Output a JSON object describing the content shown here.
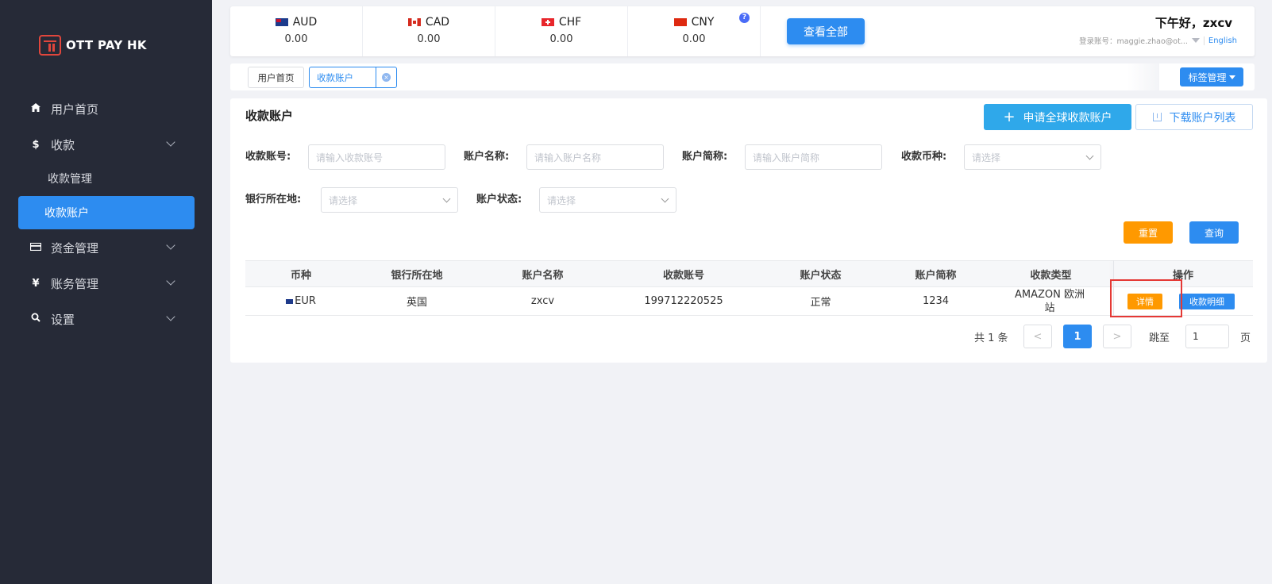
{
  "sidebar": {
    "brand": "OTT PAY HK",
    "items": [
      {
        "label": "用户首页",
        "icon": "home-icon"
      },
      {
        "label": "收款",
        "icon": "dollar-icon"
      },
      {
        "label": "收款管理"
      },
      {
        "label": "收款账户"
      },
      {
        "label": "资金管理",
        "icon": "card-icon"
      },
      {
        "label": "账务管理",
        "icon": "yen-icon"
      },
      {
        "label": "设置",
        "icon": "search-icon"
      }
    ]
  },
  "currencies": [
    {
      "code": "AUD",
      "value": "0.00"
    },
    {
      "code": "CAD",
      "value": "0.00"
    },
    {
      "code": "CHF",
      "value": "0.00"
    },
    {
      "code": "CNY",
      "value": "0.00"
    }
  ],
  "header": {
    "help": "?",
    "view_all": "查看全部",
    "greeting": "下午好，zxcv",
    "account": "登录账号：maggie.zhao@ot...",
    "language": "English"
  },
  "tabs": {
    "items": [
      "用户首页",
      "收款账户"
    ],
    "close": "×",
    "tag_management": "标签管理"
  },
  "page": {
    "title": "收款账户",
    "apply_plus": "+",
    "apply_button": "申请全球收款账户",
    "download_button": "下载账户列表"
  },
  "filters": {
    "account_no_label": "收款账号:",
    "account_no_placeholder": "请输入收款账号",
    "account_name_label": "账户名称:",
    "account_name_placeholder": "请输入账户名称",
    "account_short_label": "账户简称:",
    "account_short_placeholder": "请输入账户简称",
    "currency_label": "收款币种:",
    "currency_placeholder": "请选择",
    "bank_location_label": "银行所在地:",
    "bank_location_placeholder": "请选择",
    "status_label": "账户状态:",
    "status_placeholder": "请选择",
    "reset": "重置",
    "query": "查询"
  },
  "table": {
    "columns": [
      "币种",
      "银行所在地",
      "账户名称",
      "收款账号",
      "账户状态",
      "账户简称",
      "收款类型",
      "操作"
    ],
    "rows": [
      {
        "currency": "EUR",
        "bank_location": "英国",
        "account_name": "zxcv",
        "account_no": "199712220525",
        "status": "正常",
        "short_name": "1234",
        "type": "AMAZON 欧洲站",
        "detail": "详情",
        "flow": "收款明细"
      }
    ]
  },
  "pagination": {
    "total": "共 1 条",
    "prev": "<",
    "current": "1",
    "next": ">",
    "jump_label": "跳至",
    "jump_value": "1",
    "page_label": "页"
  },
  "colors": {
    "sidebar_bg": "#262a37",
    "primary": "#2d8cf0",
    "warning": "#ff9900",
    "highlight": "#e53935"
  }
}
